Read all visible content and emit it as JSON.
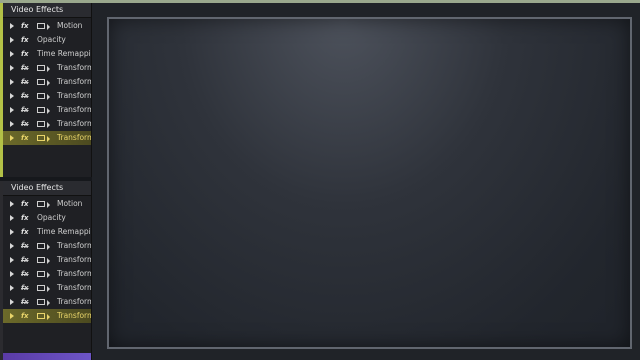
{
  "panel_top": {
    "title": "Video Effects",
    "rows": [
      {
        "label": "Motion",
        "icon": "fx-icon",
        "film": true
      },
      {
        "label": "Opacity",
        "icon": "fx-icon",
        "film": false
      },
      {
        "label": "Time Remapping",
        "icon": "fx-icon",
        "film": false
      },
      {
        "label": "Transform",
        "icon": "fx-crossed-icon",
        "film": true
      },
      {
        "label": "Transform",
        "icon": "fx-crossed-icon",
        "film": true
      },
      {
        "label": "Transform",
        "icon": "fx-crossed-icon",
        "film": true
      },
      {
        "label": "Transform",
        "icon": "fx-crossed-icon",
        "film": true
      },
      {
        "label": "Transform",
        "icon": "fx-crossed-icon",
        "film": true
      },
      {
        "label": "Transform",
        "icon": "fx-icon",
        "film": true,
        "highlight": true
      }
    ]
  },
  "panel_bottom": {
    "title": "Video Effects",
    "rows": [
      {
        "label": "Motion",
        "icon": "fx-icon",
        "film": true
      },
      {
        "label": "Opacity",
        "icon": "fx-icon",
        "film": false
      },
      {
        "label": "Time Remapping",
        "icon": "fx-icon",
        "film": false
      },
      {
        "label": "Transform",
        "icon": "fx-crossed-icon",
        "film": true
      },
      {
        "label": "Transform",
        "icon": "fx-crossed-icon",
        "film": true
      },
      {
        "label": "Transform",
        "icon": "fx-crossed-icon",
        "film": true
      },
      {
        "label": "Transform",
        "icon": "fx-crossed-icon",
        "film": true
      },
      {
        "label": "Transform",
        "icon": "fx-crossed-icon",
        "film": true
      },
      {
        "label": "Transform",
        "icon": "fx-icon",
        "film": true,
        "highlight": true
      }
    ]
  },
  "fx_glyph": "fx",
  "colors": {
    "accent_top": "#9aa88d",
    "panel_top_border": "#b3c147",
    "panel_bottom_bar": "#6d55c7",
    "highlight": "#e8d46a"
  }
}
